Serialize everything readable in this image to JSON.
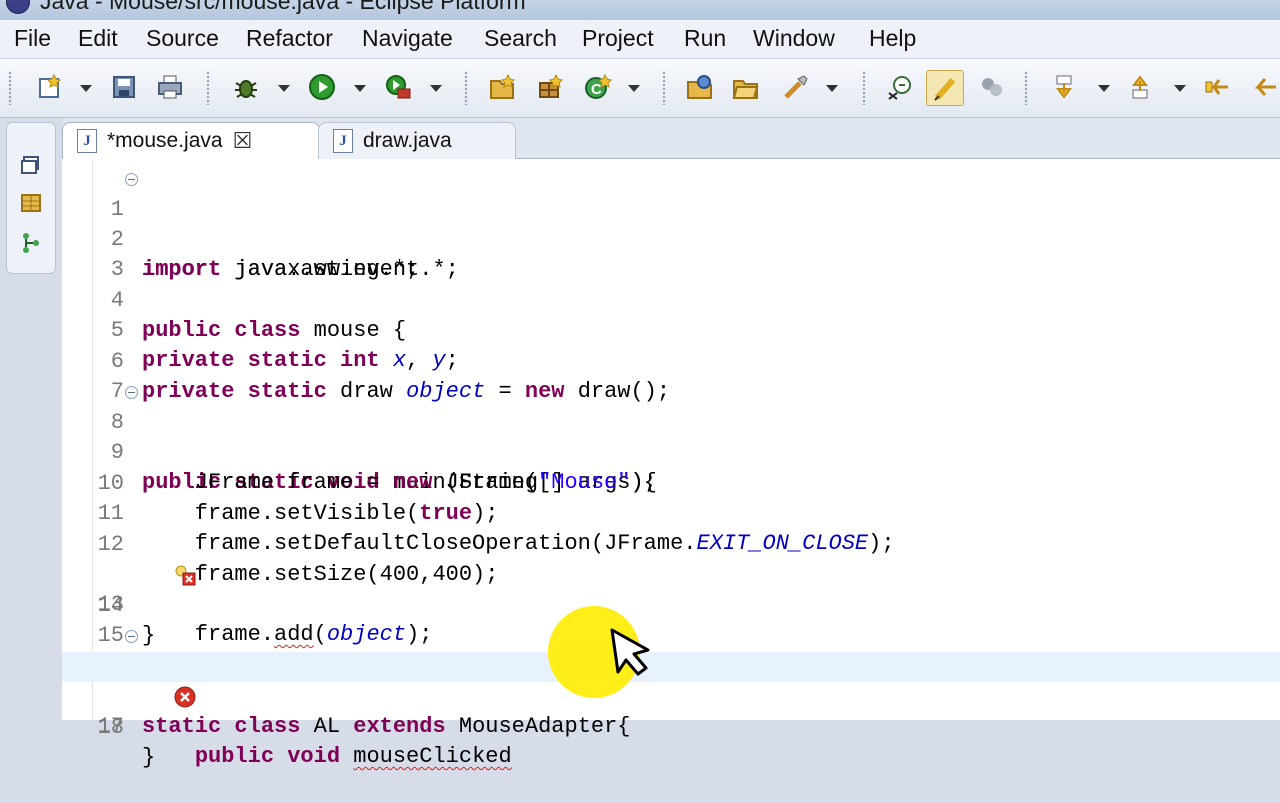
{
  "window": {
    "title": "Java - Mouse/src/mouse.java - Eclipse Platform"
  },
  "menu": [
    "File",
    "Edit",
    "Source",
    "Refactor",
    "Navigate",
    "Search",
    "Project",
    "Run",
    "Window",
    "Help"
  ],
  "toolbar": {
    "icons": [
      "new-wizard-icon",
      "save-icon",
      "print-icon",
      "debug-icon",
      "run-icon",
      "external-tools-icon",
      "new-java-project-icon",
      "new-package-icon",
      "new-class-icon",
      "open-type-icon",
      "open-folder-icon",
      "search-icon",
      "toggle-breadcrumb-icon",
      "toggle-mark-occurrences-icon",
      "show-whitespace-icon",
      "next-annotation-icon",
      "previous-annotation-icon",
      "last-edit-icon",
      "back-icon"
    ]
  },
  "editor": {
    "tabs": [
      {
        "label": "*mouse.java",
        "active": true
      },
      {
        "label": "draw.java",
        "active": false
      }
    ],
    "lines": [
      {
        "num": "1",
        "fold": true,
        "code": "import javax.swing.*;"
      },
      {
        "num": "2",
        "code": "import java.awt.event.*;"
      },
      {
        "num": "3",
        "code": ""
      },
      {
        "num": "4",
        "code": "public class mouse {"
      },
      {
        "num": "5",
        "code": "private static int x, y;"
      },
      {
        "num": "6",
        "code": "private static draw object = new draw();"
      },
      {
        "num": "7",
        "code": ""
      },
      {
        "num": "8",
        "fold": true,
        "code": "public static void main(String[] args){"
      },
      {
        "num": "9",
        "code": "    JFrame frame = new JFrame(\"Mouse\");"
      },
      {
        "num": "10",
        "code": "    frame.setVisible(true);"
      },
      {
        "num": "11",
        "code": "    frame.setDefaultCloseOperation(JFrame.EXIT_ON_CLOSE);"
      },
      {
        "num": "12",
        "code": "    frame.setSize(400,400);"
      },
      {
        "num": "13",
        "code": "    frame.add(object);",
        "marker": "warning-error"
      },
      {
        "num": "14",
        "code": "}"
      },
      {
        "num": "15",
        "code": ""
      },
      {
        "num": "16",
        "fold": true,
        "code": "static class AL extends MouseAdapter{"
      },
      {
        "num": "17",
        "code": "    public void mouseClicked",
        "marker": "error",
        "current": true
      },
      {
        "num": "18",
        "code": "}"
      }
    ]
  },
  "colors": {
    "keyword": "#7f0055",
    "field": "#0000c0",
    "string": "#2a00ff",
    "error": "#e02020",
    "current_line": "#e8f2fe"
  }
}
